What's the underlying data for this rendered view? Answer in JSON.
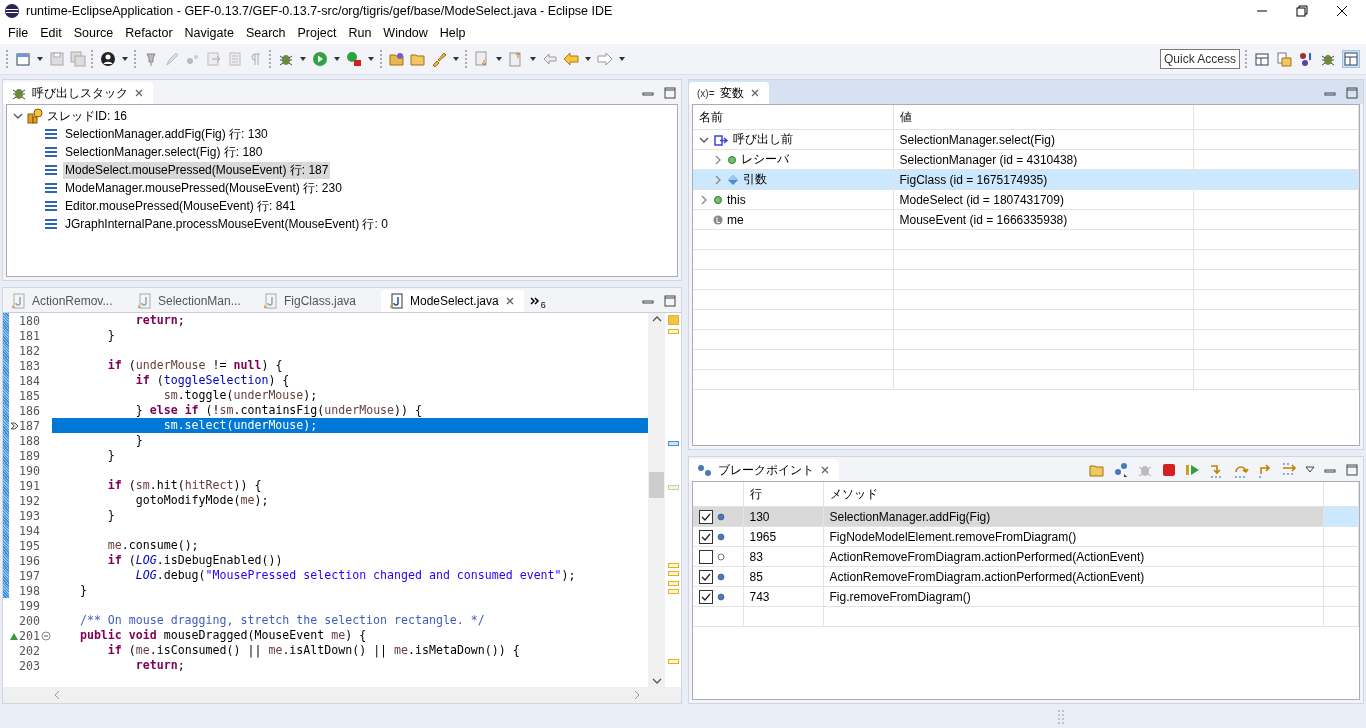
{
  "window": {
    "title": "runtime-EclipseApplication - GEF-0.13.7/GEF-0.13.7-src/org/tigris/gef/base/ModeSelect.java - Eclipse IDE"
  },
  "menu": [
    "File",
    "Edit",
    "Source",
    "Refactor",
    "Navigate",
    "Search",
    "Project",
    "Run",
    "Window",
    "Help"
  ],
  "quick_access": {
    "placeholder": "Quick Access"
  },
  "call_stack": {
    "title": "呼び出しスタック",
    "thread": {
      "label": "スレッドID: 16",
      "expanded": true,
      "frames": [
        {
          "label": "SelectionManager.addFig(Fig) 行: 130",
          "selected": false
        },
        {
          "label": "SelectionManager.select(Fig) 行: 180",
          "selected": false
        },
        {
          "label": "ModeSelect.mousePressed(MouseEvent) 行: 187",
          "selected": true
        },
        {
          "label": "ModeManager.mousePressed(MouseEvent) 行: 230",
          "selected": false
        },
        {
          "label": "Editor.mousePressed(MouseEvent) 行: 841",
          "selected": false
        },
        {
          "label": "JGraphInternalPane.processMouseEvent(MouseEvent) 行: 0",
          "selected": false
        }
      ]
    }
  },
  "editor": {
    "tabs": [
      {
        "label": "ActionRemov...",
        "selected": false
      },
      {
        "label": "SelectionMan...",
        "selected": false
      },
      {
        "label": "FigClass.java",
        "selected": false
      },
      {
        "label": "ModeSelect.java",
        "selected": true
      }
    ],
    "overflow_count": "6",
    "lines": [
      {
        "num": "180",
        "in_range": true,
        "current": false,
        "tokens": [
          {
            "kind": "kw",
            "text": "            return"
          },
          {
            "kind": "plain",
            "text": ";"
          }
        ]
      },
      {
        "num": "181",
        "in_range": true,
        "current": false,
        "tokens": [
          {
            "kind": "plain",
            "text": "        }"
          }
        ]
      },
      {
        "num": "182",
        "in_range": true,
        "current": false
      },
      {
        "num": "183",
        "in_range": true,
        "current": false,
        "tokens": [
          {
            "kind": "kw",
            "text": "        if"
          },
          {
            "kind": "plain",
            "text": " ("
          },
          {
            "kind": "local",
            "text": "underMouse"
          },
          {
            "kind": "plain",
            "text": " != "
          },
          {
            "kind": "kw",
            "text": "null"
          },
          {
            "kind": "plain",
            "text": ") {"
          }
        ]
      },
      {
        "num": "184",
        "in_range": true,
        "current": false,
        "tokens": [
          {
            "kind": "kw",
            "text": "            if"
          },
          {
            "kind": "plain",
            "text": " ("
          },
          {
            "kind": "field",
            "text": "toggleSelection"
          },
          {
            "kind": "plain",
            "text": ") {"
          }
        ]
      },
      {
        "num": "185",
        "in_range": true,
        "current": false,
        "tokens": [
          {
            "kind": "local",
            "text": "                sm"
          },
          {
            "kind": "plain",
            "text": ".toggle("
          },
          {
            "kind": "local",
            "text": "underMouse"
          },
          {
            "kind": "plain",
            "text": ");"
          }
        ]
      },
      {
        "num": "186",
        "in_range": true,
        "current": false,
        "tokens": [
          {
            "kind": "plain",
            "text": "            } "
          },
          {
            "kind": "kw",
            "text": "else if"
          },
          {
            "kind": "plain",
            "text": " (!"
          },
          {
            "kind": "local",
            "text": "sm"
          },
          {
            "kind": "plain",
            "text": ".containsFig("
          },
          {
            "kind": "local",
            "text": "underMouse"
          },
          {
            "kind": "plain",
            "text": ")) {"
          }
        ]
      },
      {
        "num": "187",
        "in_range": true,
        "current": true,
        "instruction_pointer": true,
        "tokens": [
          {
            "kind": "local",
            "text": "                sm"
          },
          {
            "kind": "plain",
            "text": ".select("
          },
          {
            "kind": "local",
            "text": "underMouse"
          },
          {
            "kind": "plain",
            "text": ");"
          }
        ]
      },
      {
        "num": "188",
        "in_range": true,
        "current": false,
        "tokens": [
          {
            "kind": "plain",
            "text": "            }"
          }
        ]
      },
      {
        "num": "189",
        "in_range": true,
        "current": false,
        "tokens": [
          {
            "kind": "plain",
            "text": "        }"
          }
        ]
      },
      {
        "num": "190",
        "in_range": true,
        "current": false
      },
      {
        "num": "191",
        "in_range": true,
        "current": false,
        "tokens": [
          {
            "kind": "kw",
            "text": "        if"
          },
          {
            "kind": "plain",
            "text": " ("
          },
          {
            "kind": "local",
            "text": "sm"
          },
          {
            "kind": "plain",
            "text": ".hit("
          },
          {
            "kind": "local",
            "text": "hitRect"
          },
          {
            "kind": "plain",
            "text": ")) {"
          }
        ]
      },
      {
        "num": "192",
        "in_range": true,
        "current": false,
        "tokens": [
          {
            "kind": "plain",
            "text": "            gotoModifyMode("
          },
          {
            "kind": "local",
            "text": "me"
          },
          {
            "kind": "plain",
            "text": ");"
          }
        ]
      },
      {
        "num": "193",
        "in_range": true,
        "current": false,
        "tokens": [
          {
            "kind": "plain",
            "text": "        }"
          }
        ]
      },
      {
        "num": "194",
        "in_range": true,
        "current": false
      },
      {
        "num": "195",
        "in_range": true,
        "current": false,
        "tokens": [
          {
            "kind": "local",
            "text": "        me"
          },
          {
            "kind": "plain",
            "text": ".consume();"
          }
        ]
      },
      {
        "num": "196",
        "in_range": true,
        "current": false,
        "tokens": [
          {
            "kind": "kw",
            "text": "        if"
          },
          {
            "kind": "plain",
            "text": " ("
          },
          {
            "kind": "static",
            "text": "LOG"
          },
          {
            "kind": "plain",
            "text": ".isDebugEnabled())"
          }
        ]
      },
      {
        "num": "197",
        "in_range": true,
        "current": false,
        "tokens": [
          {
            "kind": "static",
            "text": "            LOG"
          },
          {
            "kind": "plain",
            "text": ".debug("
          },
          {
            "kind": "str",
            "text": "\"MousePressed selection changed and consumed event\""
          },
          {
            "kind": "plain",
            "text": ");"
          }
        ]
      },
      {
        "num": "198",
        "in_range": true,
        "current": false,
        "tokens": [
          {
            "kind": "plain",
            "text": "    }"
          }
        ]
      },
      {
        "num": "199",
        "in_range": false,
        "current": false
      },
      {
        "num": "200",
        "in_range": false,
        "current": false,
        "tokens": [
          {
            "kind": "comment",
            "text": "    /** On mouse dragging, stretch the selection rectangle. */"
          }
        ]
      },
      {
        "num": "201",
        "in_range": false,
        "current": false,
        "override": true,
        "foldable": true,
        "tokens": [
          {
            "kind": "kw",
            "text": "    public void"
          },
          {
            "kind": "plain",
            "text": " mouseDragged(MouseEvent "
          },
          {
            "kind": "local",
            "text": "me"
          },
          {
            "kind": "plain",
            "text": ") {"
          }
        ]
      },
      {
        "num": "202",
        "in_range": false,
        "current": false,
        "tokens": [
          {
            "kind": "kw",
            "text": "        if"
          },
          {
            "kind": "plain",
            "text": " ("
          },
          {
            "kind": "local",
            "text": "me"
          },
          {
            "kind": "plain",
            "text": ".isConsumed() || "
          },
          {
            "kind": "local",
            "text": "me"
          },
          {
            "kind": "plain",
            "text": ".isAltDown() || "
          },
          {
            "kind": "local",
            "text": "me"
          },
          {
            "kind": "plain",
            "text": ".isMetaDown()) {"
          }
        ]
      },
      {
        "num": "203",
        "in_range": false,
        "current": false,
        "tokens": [
          {
            "kind": "kw",
            "text": "            return"
          },
          {
            "kind": "plain",
            "text": ";"
          }
        ]
      }
    ]
  },
  "variables": {
    "tab_icon_text": "(x)=",
    "title": "変数",
    "columns": [
      "名前",
      "値"
    ],
    "rows": [
      {
        "name": "呼び出し前",
        "value": "SelectionManager.select(Fig)",
        "kind": "result",
        "expanded": true,
        "selected": false,
        "children": [
          {
            "name": "レシーバ",
            "value": "SelectionManager (id = 4310438)",
            "kind": "object",
            "expanded": false,
            "selected": false
          },
          {
            "name": "引数",
            "value": "FigClass (id = 1675174935)",
            "kind": "argument",
            "expanded": false,
            "selected": true
          }
        ]
      },
      {
        "name": "this",
        "value": "ModeSelect (id = 1807431709)",
        "kind": "object",
        "expanded": false,
        "selected": false
      },
      {
        "name": "me",
        "value": "MouseEvent (id = 1666335938)",
        "kind": "local",
        "selected": false
      }
    ]
  },
  "breakpoints": {
    "title": "ブレークポイント",
    "columns": [
      "行",
      "メソッド"
    ],
    "rows": [
      {
        "checked": true,
        "line": "130",
        "method": "SelectionManager.addFig(Fig)",
        "selected": true
      },
      {
        "checked": true,
        "line": "1965",
        "method": "FigNodeModelElement.removeFromDiagram()",
        "selected": false
      },
      {
        "checked": false,
        "line": "83",
        "method": "ActionRemoveFromDiagram.actionPerformed(ActionEvent)",
        "selected": false
      },
      {
        "checked": true,
        "line": "85",
        "method": "ActionRemoveFromDiagram.actionPerformed(ActionEvent)",
        "selected": false
      },
      {
        "checked": true,
        "line": "743",
        "method": "Fig.removeFromDiagram()",
        "selected": false
      }
    ]
  }
}
